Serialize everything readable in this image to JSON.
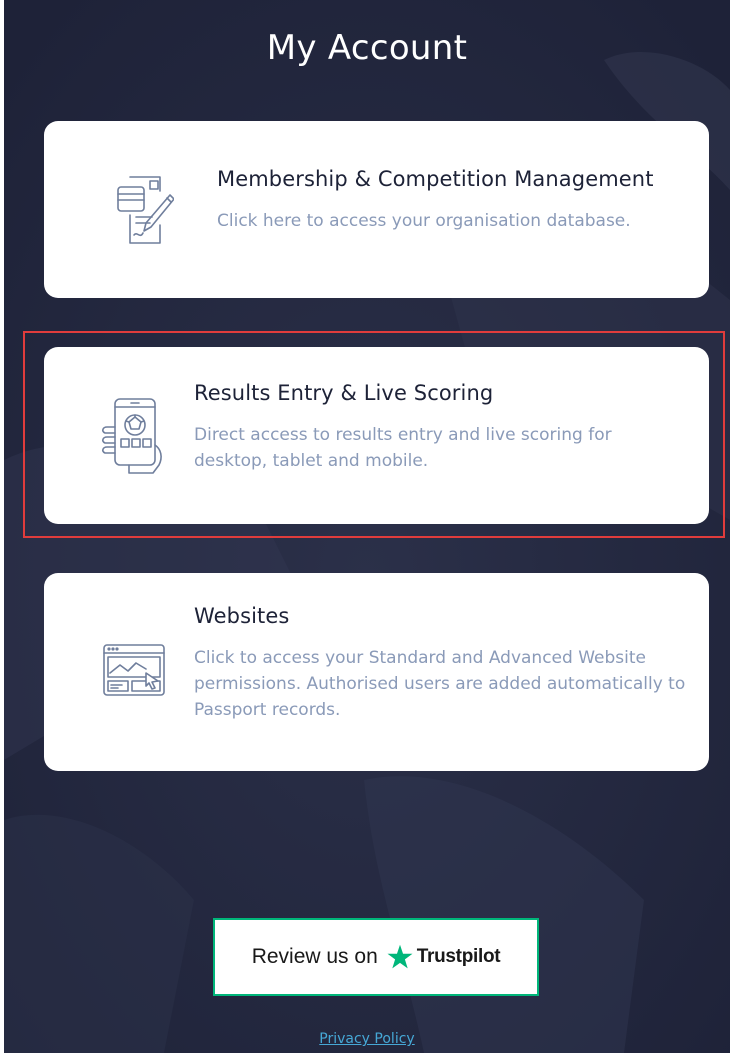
{
  "page": {
    "title": "My Account"
  },
  "cards": [
    {
      "title": "Membership & Competition Management",
      "description": "Click here to access your organisation database.",
      "icon": "document-edit-icon"
    },
    {
      "title": "Results Entry & Live Scoring",
      "description": "Direct access to results entry and live scoring for desktop, tablet and mobile.",
      "icon": "mobile-scoring-icon"
    },
    {
      "title": "Websites",
      "description": "Click to access your Standard and Advanced Website permissions. Authorised users are added automatically to Passport records.",
      "icon": "website-browser-icon"
    }
  ],
  "trustpilot": {
    "prefix": "Review us on",
    "brand": "Trustpilot",
    "star_color": "#00b67a"
  },
  "footer": {
    "privacy_label": "Privacy Policy"
  },
  "colors": {
    "background": "#22263e",
    "card_title": "#1d2237",
    "card_description": "#8a9ab8",
    "icon_stroke": "#6f7e9c",
    "highlight_border": "#e03c3c",
    "link": "#46a8d6"
  }
}
